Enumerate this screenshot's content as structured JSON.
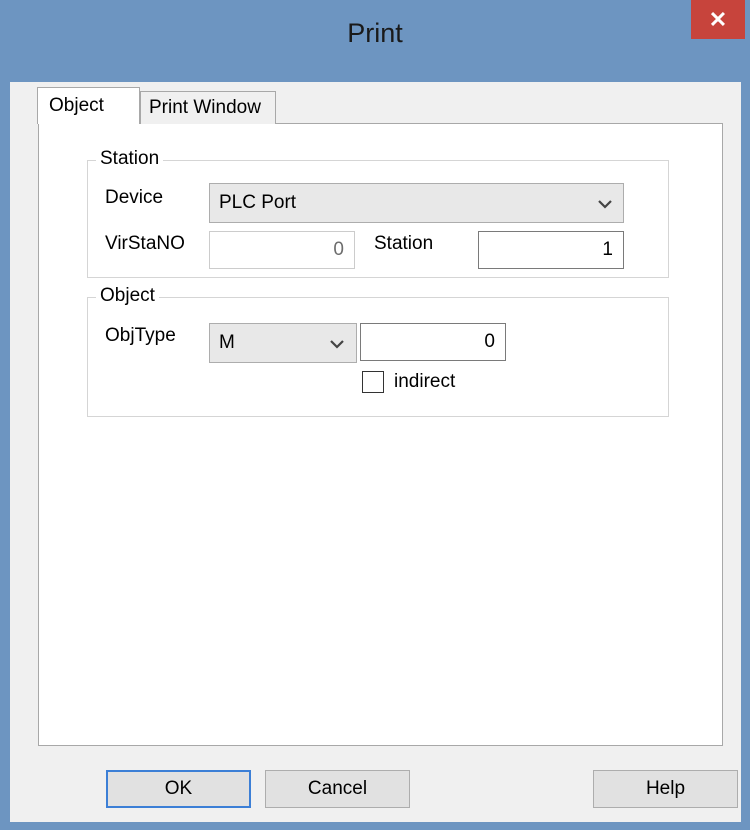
{
  "window": {
    "title": "Print",
    "close_glyph": "✕"
  },
  "tabs": [
    {
      "label": "Object",
      "active": true
    },
    {
      "label": "Print Window",
      "active": false
    }
  ],
  "station_group": {
    "label": "Station",
    "device_label": "Device",
    "device_value": "PLC Port",
    "virstano_label": "VirStaNO",
    "virstano_value": "0",
    "station_label": "Station",
    "station_value": "1"
  },
  "object_group": {
    "label": "Object",
    "objtype_label": "ObjType",
    "objtype_value": "M",
    "address_value": "0",
    "indirect_label": "indirect",
    "indirect_checked": false
  },
  "buttons": {
    "ok": "OK",
    "cancel": "Cancel",
    "help": "Help"
  },
  "colors": {
    "titlebar": "#6d95c1",
    "close_button": "#c7443c",
    "default_button_border": "#3c7fd6"
  },
  "icons": {
    "close": "close-icon",
    "dropdown": "chevron-down-icon"
  }
}
